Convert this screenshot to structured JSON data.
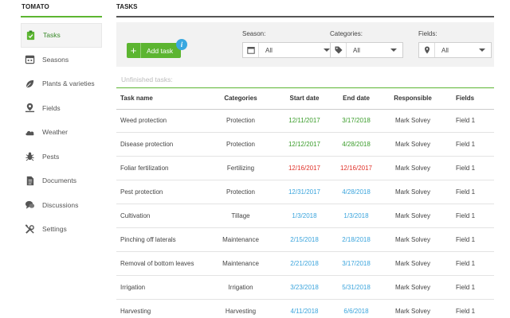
{
  "app": {
    "title": "TOMATO"
  },
  "sidebar": {
    "items": [
      {
        "label": "Tasks",
        "icon": "clipboard-check-icon",
        "active": true
      },
      {
        "label": "Seasons",
        "icon": "calendar-icon",
        "active": false
      },
      {
        "label": "Plants & varieties",
        "icon": "leaf-icon",
        "active": false
      },
      {
        "label": "Fields",
        "icon": "map-pin-icon",
        "active": false
      },
      {
        "label": "Weather",
        "icon": "cloud-icon",
        "active": false
      },
      {
        "label": "Pests",
        "icon": "bug-icon",
        "active": false
      },
      {
        "label": "Documents",
        "icon": "document-icon",
        "active": false
      },
      {
        "label": "Discussions",
        "icon": "chat-icon",
        "active": false
      },
      {
        "label": "Settings",
        "icon": "tools-icon",
        "active": false
      }
    ]
  },
  "main": {
    "title": "TASKS",
    "add_task_label": "Add task",
    "info_icon_glyph": "i",
    "filters": {
      "season": {
        "label": "Season:",
        "value": "All",
        "icon": "calendar-icon"
      },
      "categories": {
        "label": "Categories:",
        "value": "All",
        "icon": "tag-icon"
      },
      "fields": {
        "label": "Fields:",
        "value": "All",
        "icon": "map-pin-icon"
      }
    },
    "section_label": "Unfinished tasks:",
    "table": {
      "headers": {
        "name": "Task name",
        "category": "Categories",
        "start": "Start date",
        "end": "End date",
        "responsible": "Responsible",
        "field": "Fields"
      },
      "rows": [
        {
          "name": "Weed protection",
          "category": "Protection",
          "start": "12/11/2017",
          "end": "3/17/2018",
          "responsible": "Mark Solvey",
          "field": "Field 1",
          "status": "green"
        },
        {
          "name": "Disease protection",
          "category": "Protection",
          "start": "12/12/2017",
          "end": "4/28/2018",
          "responsible": "Mark Solvey",
          "field": "Field 1",
          "status": "green"
        },
        {
          "name": "Foliar fertilization",
          "category": "Fertilizing",
          "start": "12/16/2017",
          "end": "12/16/2017",
          "responsible": "Mark Solvey",
          "field": "Field 1",
          "status": "red"
        },
        {
          "name": "Pest protection",
          "category": "Protection",
          "start": "12/31/2017",
          "end": "4/28/2018",
          "responsible": "Mark Solvey",
          "field": "Field 1",
          "status": "blue"
        },
        {
          "name": "Cultivation",
          "category": "Tillage",
          "start": "1/3/2018",
          "end": "1/3/2018",
          "responsible": "Mark Solvey",
          "field": "Field 1",
          "status": "blue"
        },
        {
          "name": "Pinching off laterals",
          "category": "Maintenance",
          "start": "2/15/2018",
          "end": "2/18/2018",
          "responsible": "Mark Solvey",
          "field": "Field 1",
          "status": "blue"
        },
        {
          "name": "Removal of bottom leaves",
          "category": "Maintenance",
          "start": "2/21/2018",
          "end": "3/17/2018",
          "responsible": "Mark Solvey",
          "field": "Field 1",
          "status": "blue"
        },
        {
          "name": "Irrigation",
          "category": "Irrigation",
          "start": "3/23/2018",
          "end": "5/31/2018",
          "responsible": "Mark Solvey",
          "field": "Field 1",
          "status": "blue"
        },
        {
          "name": "Harvesting",
          "category": "Harvesting",
          "start": "4/11/2018",
          "end": "6/6/2018",
          "responsible": "Mark Solvey",
          "field": "Field 1",
          "status": "blue"
        }
      ]
    }
  },
  "colors": {
    "accent": "#5cb531",
    "date_green": "#3a9c2a",
    "date_red": "#e0332b",
    "date_blue": "#3aa4dc",
    "info": "#39a8e0"
  }
}
